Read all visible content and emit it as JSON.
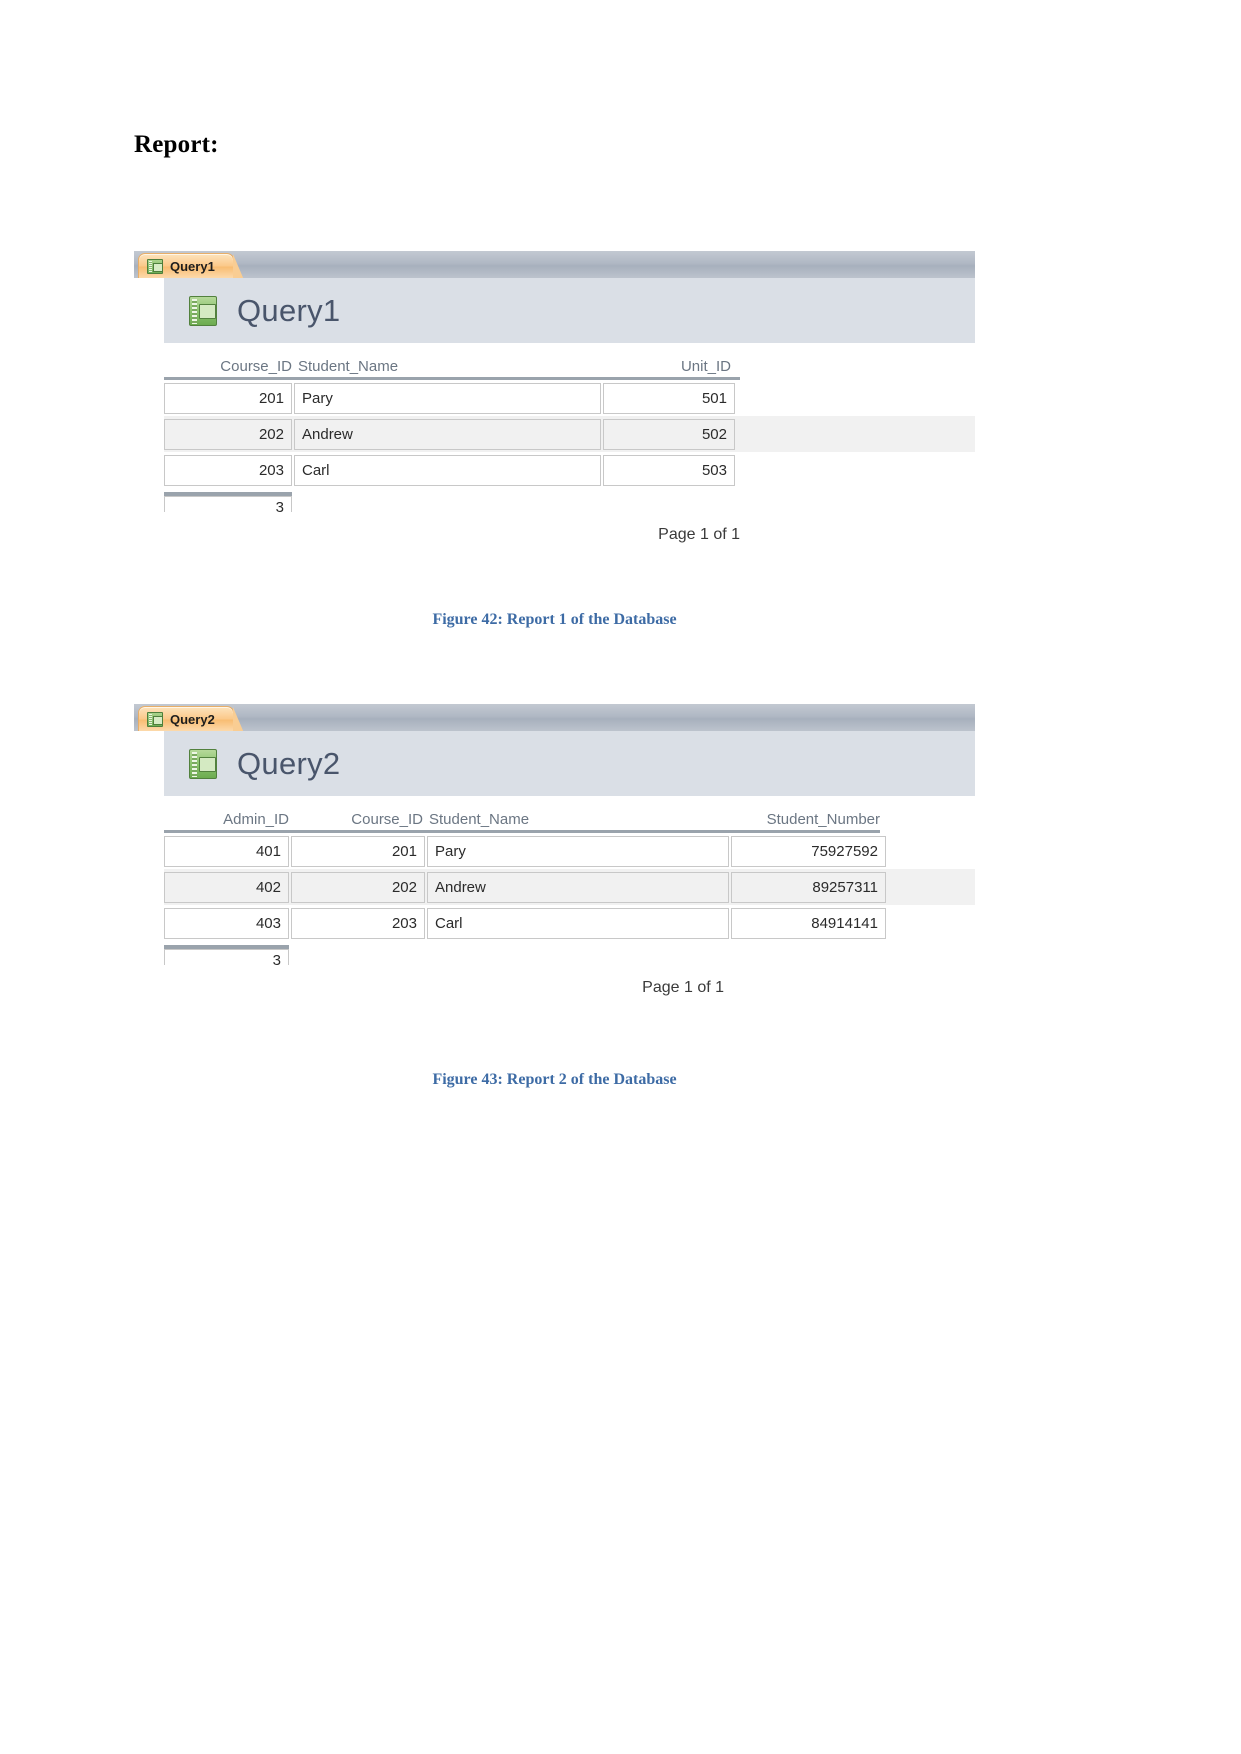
{
  "document": {
    "heading": "Report:"
  },
  "reports": [
    {
      "tab_label": "Query1",
      "tab_icon": "notebook-icon",
      "title": "Query1",
      "title_icon": "notebook-icon",
      "columns": [
        "Course_ID",
        "Student_Name",
        "Unit_ID"
      ],
      "rows": [
        [
          "201",
          "Pary",
          "501"
        ],
        [
          "202",
          "Andrew",
          "502"
        ],
        [
          "203",
          "Carl",
          "503"
        ]
      ],
      "record_count": "3",
      "page_footer": "Page 1 of 1",
      "caption": "Figure 42: Report 1 of the Database"
    },
    {
      "tab_label": "Query2",
      "tab_icon": "notebook-icon",
      "title": "Query2",
      "title_icon": "notebook-icon",
      "columns": [
        "Admin_ID",
        "Course_ID",
        "Student_Name",
        "Student_Number"
      ],
      "rows": [
        [
          "401",
          "201",
          "Pary",
          "75927592"
        ],
        [
          "402",
          "202",
          "Andrew",
          "89257311"
        ],
        [
          "403",
          "203",
          "Carl",
          "84914141"
        ]
      ],
      "record_count": "3",
      "page_footer": "Page 1 of 1",
      "caption": "Figure 43: Report 2 of the Database"
    }
  ],
  "colors": {
    "tab_active": "#f8bd72",
    "tab_strip": "#b0b8c4",
    "report_header": "#dadfe6",
    "title_text": "#49556b",
    "caption": "#3d6ba5",
    "row_alt": "#f1f1f1"
  }
}
